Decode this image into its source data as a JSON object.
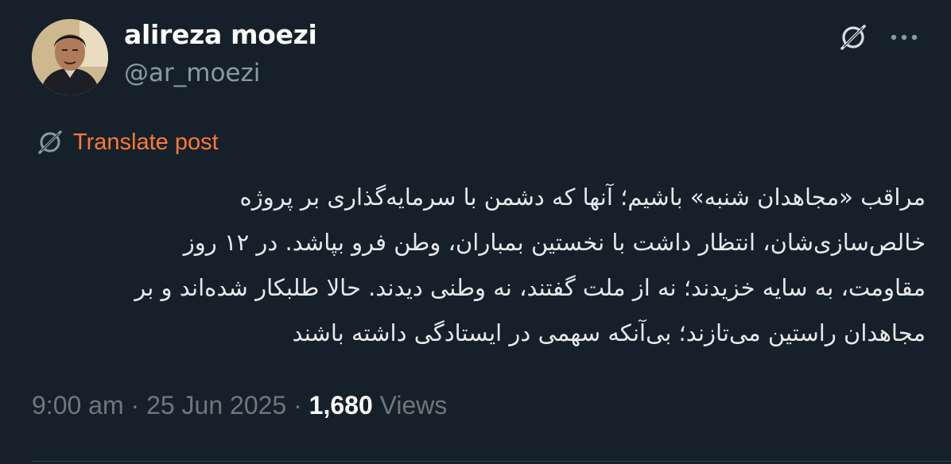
{
  "author": {
    "display_name": "alireza moezi",
    "handle": "@ar_moezi"
  },
  "icons": {
    "grok": "grok-icon",
    "more": "more-options-icon",
    "translate": "translate-icon"
  },
  "translate_label": "Translate post",
  "post_lines": [
    "مراقب «مجاهدان شنبه» باشیم؛ آنها که دشمن با سرمایه‌گذاری بر پروژه",
    "خالص‌سازی‌شان، انتظار داشت با نخستین بمباران، وطن فرو بپاشد. در ۱۲ روز",
    "مقاومت، به سایه خزیدند؛ نه از ملت گفتند، نه وطنی دیدند. حالا طلبکار شده‌اند و بر",
    "مجاهدان راستین می‌تازند؛ بی‌آنکه سهمی در ایستادگی داشته باشند"
  ],
  "meta": {
    "time": "9:00 am",
    "separator": " · ",
    "date": "25 Jun 2025",
    "views_count": "1,680",
    "views_label": "Views"
  },
  "colors": {
    "background": "#15202b",
    "text": "#e7e9ea",
    "muted": "#71767b",
    "translate_accent": "#ff7a30"
  }
}
